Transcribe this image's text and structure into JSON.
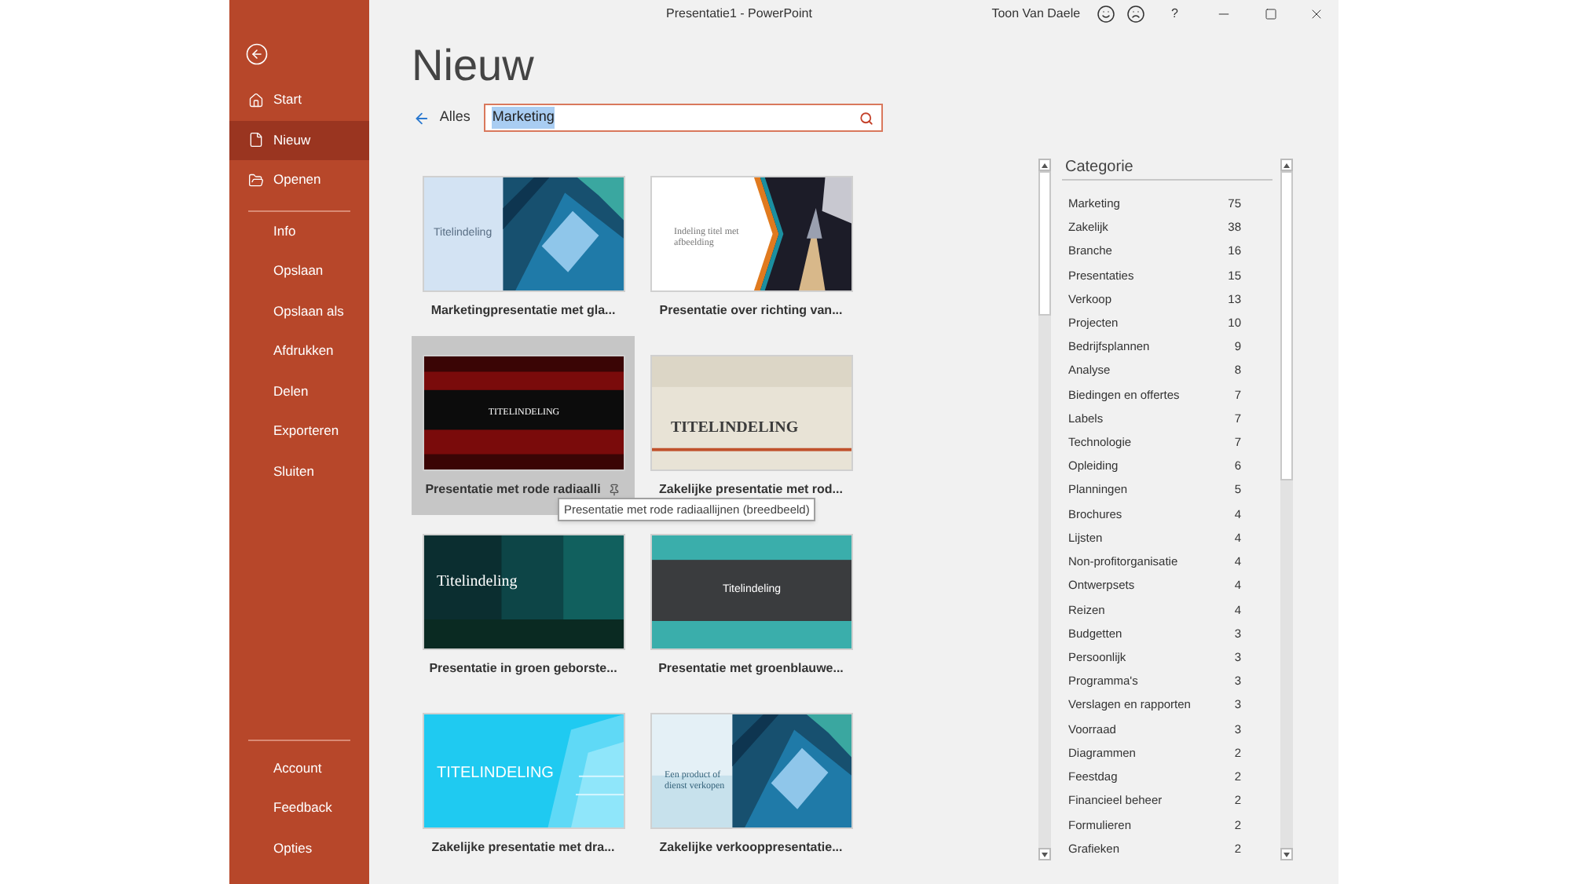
{
  "window": {
    "title": "Presentatie1 - PowerPoint",
    "user": "Toon Van Daele",
    "help": "?"
  },
  "sidebar": {
    "top": [
      {
        "label": "Start",
        "selected": false
      },
      {
        "label": "Nieuw",
        "selected": true
      },
      {
        "label": "Openen",
        "selected": false
      }
    ],
    "middle": [
      {
        "label": "Info",
        "selected": false
      },
      {
        "label": "Opslaan",
        "selected": false
      },
      {
        "label": "Opslaan als",
        "selected": false
      },
      {
        "label": "Afdrukken",
        "selected": false
      },
      {
        "label": "Delen",
        "selected": false
      },
      {
        "label": "Exporteren",
        "selected": false
      },
      {
        "label": "Sluiten",
        "selected": false
      }
    ],
    "bottom": [
      {
        "label": "Account",
        "selected": false
      },
      {
        "label": "Feedback",
        "selected": false
      },
      {
        "label": "Opties",
        "selected": false
      }
    ]
  },
  "page": {
    "heading": "Nieuw",
    "back_link": "Alles",
    "search": {
      "value": "Marketing",
      "text_selected": true
    }
  },
  "templates": [
    {
      "title": "Marketingpresentatie met gla...",
      "kind": "glass",
      "slide_title": "Titelindeling",
      "hovered": false
    },
    {
      "title": "Presentatie over richting van...",
      "kind": "chevron",
      "slide_title": "Indeling titel met afbeelding",
      "hovered": false
    },
    {
      "title": "Presentatie met rode radiaalli",
      "kind": "red",
      "slide_title": "TITELINDELING",
      "hovered": true
    },
    {
      "title": "Zakelijke presentatie met rod...",
      "kind": "beige",
      "slide_title": "TITELINDELING",
      "hovered": false
    },
    {
      "title": "Presentatie in groen geborste...",
      "kind": "green",
      "slide_title": "Titelindeling",
      "hovered": false
    },
    {
      "title": "Presentatie met groenblauwe...",
      "kind": "teal",
      "slide_title": "Titelindeling",
      "hovered": false
    },
    {
      "title": "Zakelijke presentatie met dra...",
      "kind": "cyan",
      "slide_title": "TITELINDELING",
      "hovered": false
    },
    {
      "title": "Zakelijke verkooppresentatie...",
      "kind": "product",
      "slide_title": "Een product of dienst verkopen",
      "hovered": false
    }
  ],
  "tooltip": "Presentatie met rode radiaallijnen (breedbeeld)",
  "categories": {
    "title": "Categorie",
    "items": [
      {
        "name": "Marketing",
        "count": "75"
      },
      {
        "name": "Zakelijk",
        "count": "38"
      },
      {
        "name": "Branche",
        "count": "16"
      },
      {
        "name": "Presentaties",
        "count": "15"
      },
      {
        "name": "Verkoop",
        "count": "13"
      },
      {
        "name": "Projecten",
        "count": "10"
      },
      {
        "name": "Bedrijfsplannen",
        "count": "9"
      },
      {
        "name": "Analyse",
        "count": "8"
      },
      {
        "name": "Biedingen en offertes",
        "count": "7"
      },
      {
        "name": "Labels",
        "count": "7"
      },
      {
        "name": "Technologie",
        "count": "7"
      },
      {
        "name": "Opleiding",
        "count": "6"
      },
      {
        "name": "Planningen",
        "count": "5"
      },
      {
        "name": "Brochures",
        "count": "4"
      },
      {
        "name": "Lijsten",
        "count": "4"
      },
      {
        "name": "Non-profitorganisatie",
        "count": "4"
      },
      {
        "name": "Ontwerpsets",
        "count": "4"
      },
      {
        "name": "Reizen",
        "count": "4"
      },
      {
        "name": "Budgetten",
        "count": "3"
      },
      {
        "name": "Persoonlijk",
        "count": "3"
      },
      {
        "name": "Programma's",
        "count": "3"
      },
      {
        "name": "Verslagen en rapporten",
        "count": "3"
      },
      {
        "name": "Voorraad",
        "count": "3"
      },
      {
        "name": "Diagrammen",
        "count": "2"
      },
      {
        "name": "Feestdag",
        "count": "2"
      },
      {
        "name": "Financieel beheer",
        "count": "2"
      },
      {
        "name": "Formulieren",
        "count": "2"
      },
      {
        "name": "Grafieken",
        "count": "2"
      }
    ]
  }
}
